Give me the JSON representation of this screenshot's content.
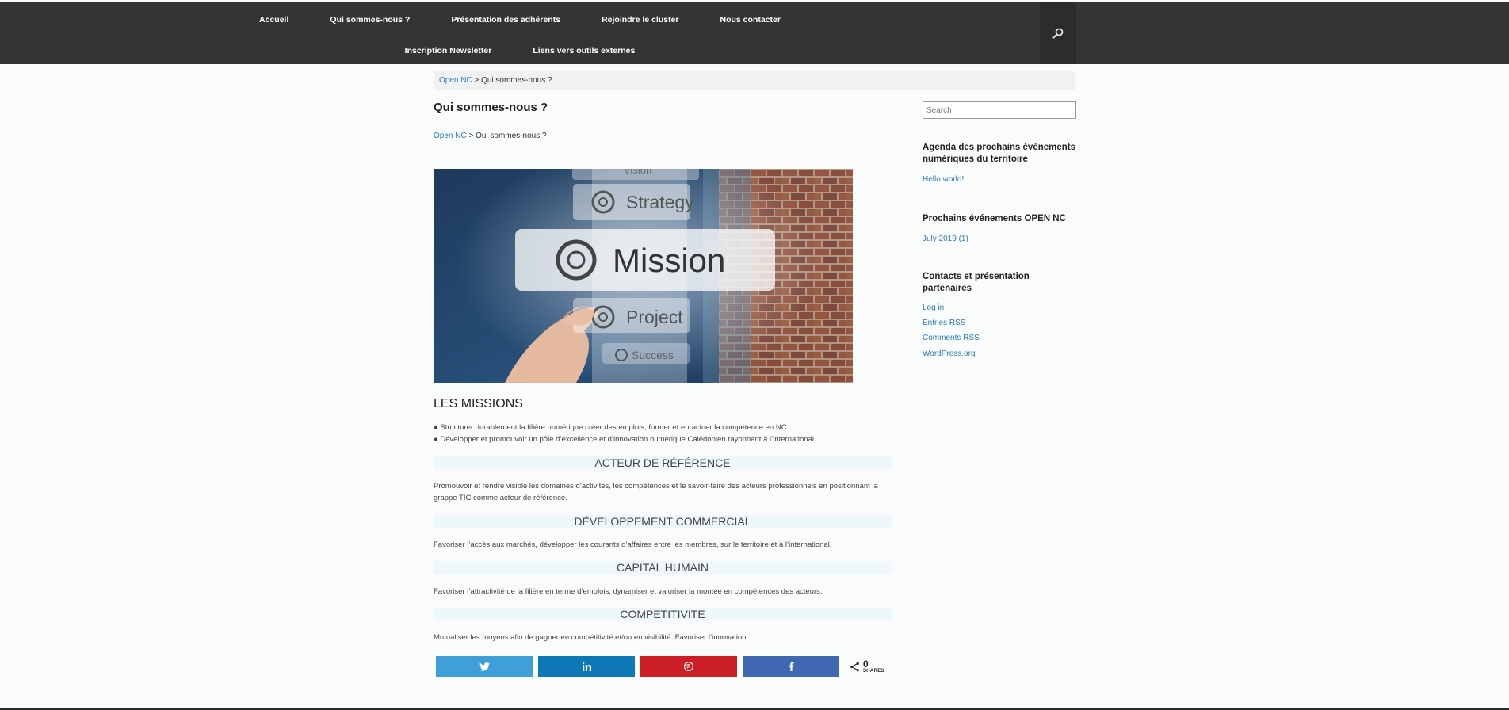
{
  "nav": {
    "row1": [
      "Accueil",
      "Qui sommes-nous ?",
      "Présentation des adhérents",
      "Rejoindre le cluster",
      "Nous contacter"
    ],
    "row2": [
      "Inscription Newsletter",
      "Liens vers outils externes"
    ],
    "search_icon": "search-icon"
  },
  "breadcrumb": {
    "home": "Open NC",
    "separator": " > ",
    "current": "Qui sommes-nous ?"
  },
  "page": {
    "title": "Qui sommes-nous ?",
    "hero_words": {
      "top": "Vision",
      "strategy": "Strategy",
      "mission": "Mission",
      "project": "Project",
      "success": "Success"
    },
    "missions_title": "LES MISSIONS",
    "bullets": [
      "● Structurer durablement la filière numérique créer des emplois, former et enraciner la compétence en NC.",
      "● Développer et promouvoir un pôle d’excellence et d’innovation numérique Calédonien rayonnant à l’international."
    ],
    "sections": [
      {
        "title": "ACTEUR DE RÉFÉRENCE",
        "text": "Promouvoir et rendre visible les domaines d’activités, les compétences et le savoir-faire des acteurs professionnels en positionnant la grappe TIC comme acteur de référence."
      },
      {
        "title": "DÉVELOPPEMENT COMMERCIAL",
        "text": "Favoriser l’accès aux marchés, développer les courants d’affaires entre les membres, sur le territoire et à l’international."
      },
      {
        "title": "CAPITAL HUMAIN",
        "text": "Favoriser l’attractivité de la filière en terme d’emplois, dynamiser et valoriser la montée en compétences des acteurs."
      },
      {
        "title": "COMPETITIVITE",
        "text": "Mutualiser les moyens afin de gagner en compétitivité et/ou en visibilité. Favoriser l’innovation."
      }
    ]
  },
  "share": {
    "buttons": [
      {
        "icon": "twitter-icon",
        "color": "#3f9fd8"
      },
      {
        "icon": "linkedin-icon",
        "color": "#0e77b5"
      },
      {
        "icon": "pinterest-icon",
        "color": "#cc1e27"
      },
      {
        "icon": "facebook-icon",
        "color": "#4067b1"
      }
    ],
    "count": "0",
    "label": "SHARES"
  },
  "sidebar": {
    "search_placeholder": "Search",
    "widgets": [
      {
        "title": "Agenda des prochains événements numériques du territoire",
        "links": [
          "Hello world!"
        ]
      },
      {
        "title": "Prochains événements OPEN NC",
        "links": [
          "July 2019 (1)"
        ]
      },
      {
        "title": "Contacts et présentation partenaires",
        "links": [
          "Log in",
          "Entries RSS",
          "Comments RSS",
          "WordPress.org"
        ]
      }
    ]
  },
  "colors": {
    "navbar": "#333436",
    "link": "#2b7bb9",
    "section_bg": "#eef7f9"
  }
}
